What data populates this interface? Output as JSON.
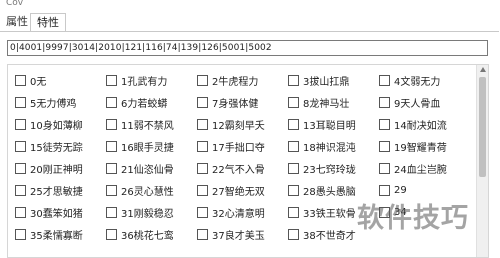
{
  "window": {
    "title": "Cov"
  },
  "tabs": [
    {
      "label": "属性",
      "active": false
    },
    {
      "label": "特性",
      "active": true
    }
  ],
  "id_field": {
    "value": "0|4001|9997|3014|2010|121|116|74|139|126|5001|5002"
  },
  "traits": [
    [
      "0无",
      "1孔武有力",
      "2牛虎程力",
      "3拔山扛鼎",
      "4文弱无力"
    ],
    [
      "5无力傅鸡",
      "6力若蛟蟒",
      "7身强体健",
      "8龙神马壮",
      "9天人骨血"
    ],
    [
      "10身如薄柳",
      "11弱不禁风",
      "12霸刻早夭",
      "13耳聪目明",
      "14耐决如流"
    ],
    [
      "15徒劳无踪",
      "16眼手灵捷",
      "17手拙口夺",
      "18神识混沌",
      "19智耀青荷"
    ],
    [
      "20刚正神明",
      "21仙恣仙骨",
      "22气不入骨",
      "23七窍玲珑",
      "24血尘岂腕"
    ],
    [
      "25才思敏捷",
      "26灵心慧性",
      "27智绝无双",
      "28愚头愚脑",
      "29"
    ],
    [
      "30蠢笨如猪",
      "31刚毅稳忍",
      "32心清意明",
      "33铁王软骨",
      "34"
    ],
    [
      "35柔懦寡断",
      "36桃花七鸾",
      "37良才美玉",
      "38不世奇才",
      ""
    ]
  ],
  "watermark": "软件技巧",
  "scrollbar": {
    "position": 0.0
  }
}
